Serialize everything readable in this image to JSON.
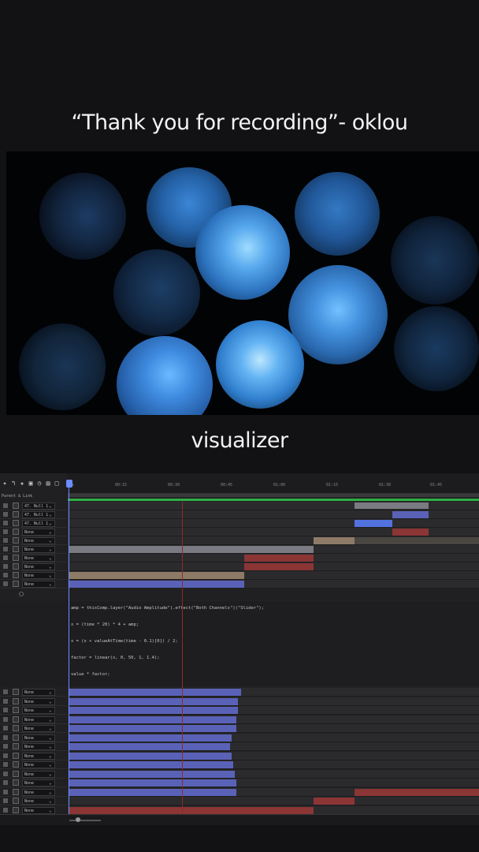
{
  "captions": {
    "top": "“Thank you for recording”- oklou",
    "bottom": "visualizer"
  },
  "timeline": {
    "comp_label": "Parent & Link",
    "ticks": [
      "0s",
      "00:15",
      "00:30",
      "00:45",
      "01:00",
      "01:15",
      "01:30",
      "01:45"
    ],
    "upper_layers": [
      {
        "parent": "47. Null 1",
        "bar": null
      },
      {
        "parent": "47. Null 1",
        "bar": null
      },
      {
        "parent": "47. Null 1",
        "bar": null
      },
      {
        "parent": "None",
        "bar": null
      },
      {
        "parent": "None",
        "bar": null
      },
      {
        "parent": "None",
        "bar": null
      },
      {
        "parent": "None",
        "bar": null
      },
      {
        "parent": "None",
        "bar": null
      },
      {
        "parent": "None",
        "bar": null
      },
      {
        "parent": "None",
        "bar": null
      }
    ],
    "expression_lines": [
      "amp = thisComp.layer(\"Audio Amplitude\").effect(\"Both Channels\")(\"Slider\");",
      "x = (time * 20) * 4 + amp;",
      "x = (x + valueAtTime(time - 0.1)[0]) / 2;",
      "factor = linear(x, 0, 50, 1, 1.4);",
      "value * factor;"
    ],
    "lower_layers": [
      "None",
      "None",
      "None",
      "None",
      "None",
      "None",
      "None",
      "None",
      "None",
      "None",
      "None",
      "None",
      "None",
      "None"
    ],
    "toolbar_icons": [
      "pin-icon",
      "keyframe-icon",
      "star-icon",
      "frame-icon",
      "stopwatch-icon",
      "graph-icon",
      "square-icon"
    ]
  },
  "colors": {
    "orb": "#3f8fd8",
    "bar_purple": "#5a62b8",
    "bar_red": "#8b3535",
    "bar_tan": "#8d7b68",
    "bar_gray": "#7a7a82",
    "bar_blue": "#5272e0"
  }
}
